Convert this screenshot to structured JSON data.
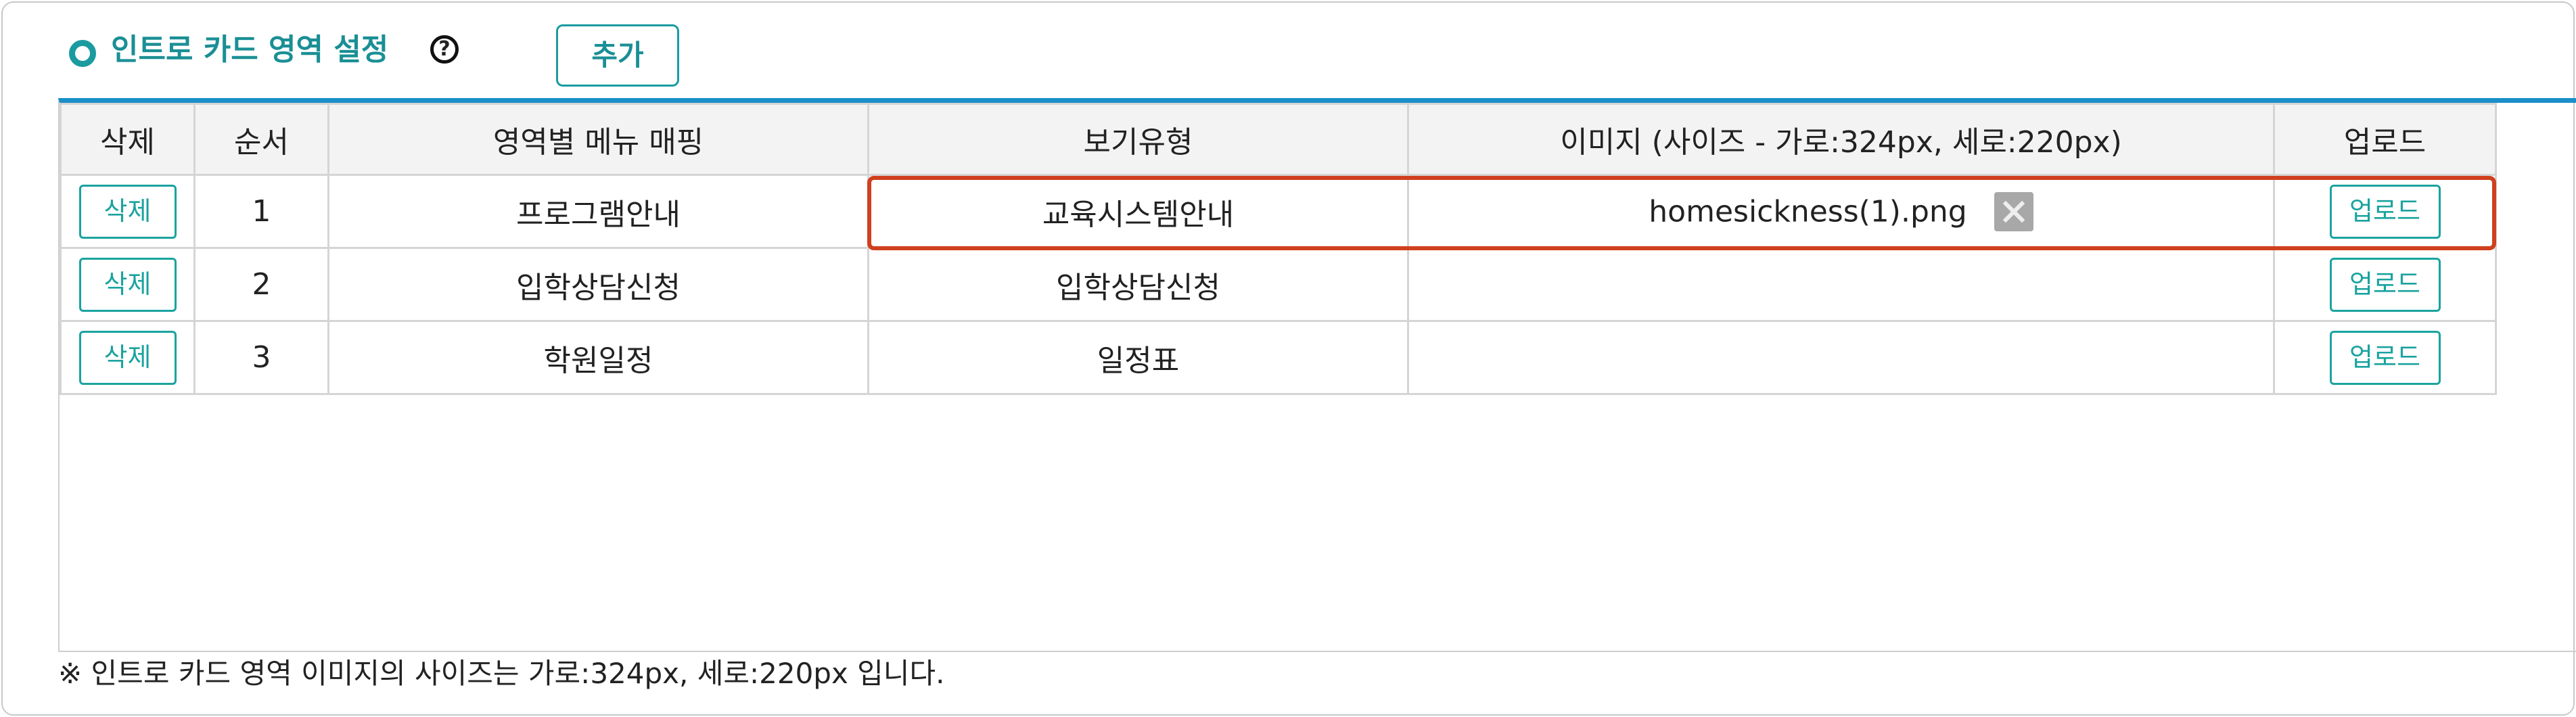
{
  "header": {
    "title": "인트로 카드 영역 설정",
    "help_icon": "question-circle-icon",
    "help_glyph": "?",
    "add_label": "추가"
  },
  "table": {
    "columns": [
      "삭제",
      "순서",
      "영역별 메뉴 매핑",
      "보기유형",
      "이미지 (사이즈 - 가로:324px, 세로:220px)",
      "업로드"
    ],
    "rows": [
      {
        "delete_label": "삭제",
        "order": "1",
        "menu": "프로그램안내",
        "view_type": "교육시스템안내",
        "image": "homesickness(1).png",
        "upload_label": "업로드"
      },
      {
        "delete_label": "삭제",
        "order": "2",
        "menu": "입학상담신청",
        "view_type": "입학상담신청",
        "image": "",
        "upload_label": "업로드"
      },
      {
        "delete_label": "삭제",
        "order": "3",
        "menu": "학원일정",
        "view_type": "일정표",
        "image": "",
        "upload_label": "업로드"
      }
    ]
  },
  "note": "※ 인트로 카드 영역 이미지의 사이즈는 가로:324px, 세로:220px 입니다.",
  "colors": {
    "accent_teal": "#1a8f95",
    "table_top_border": "#1a8fc8",
    "highlight": "#d0401e"
  }
}
